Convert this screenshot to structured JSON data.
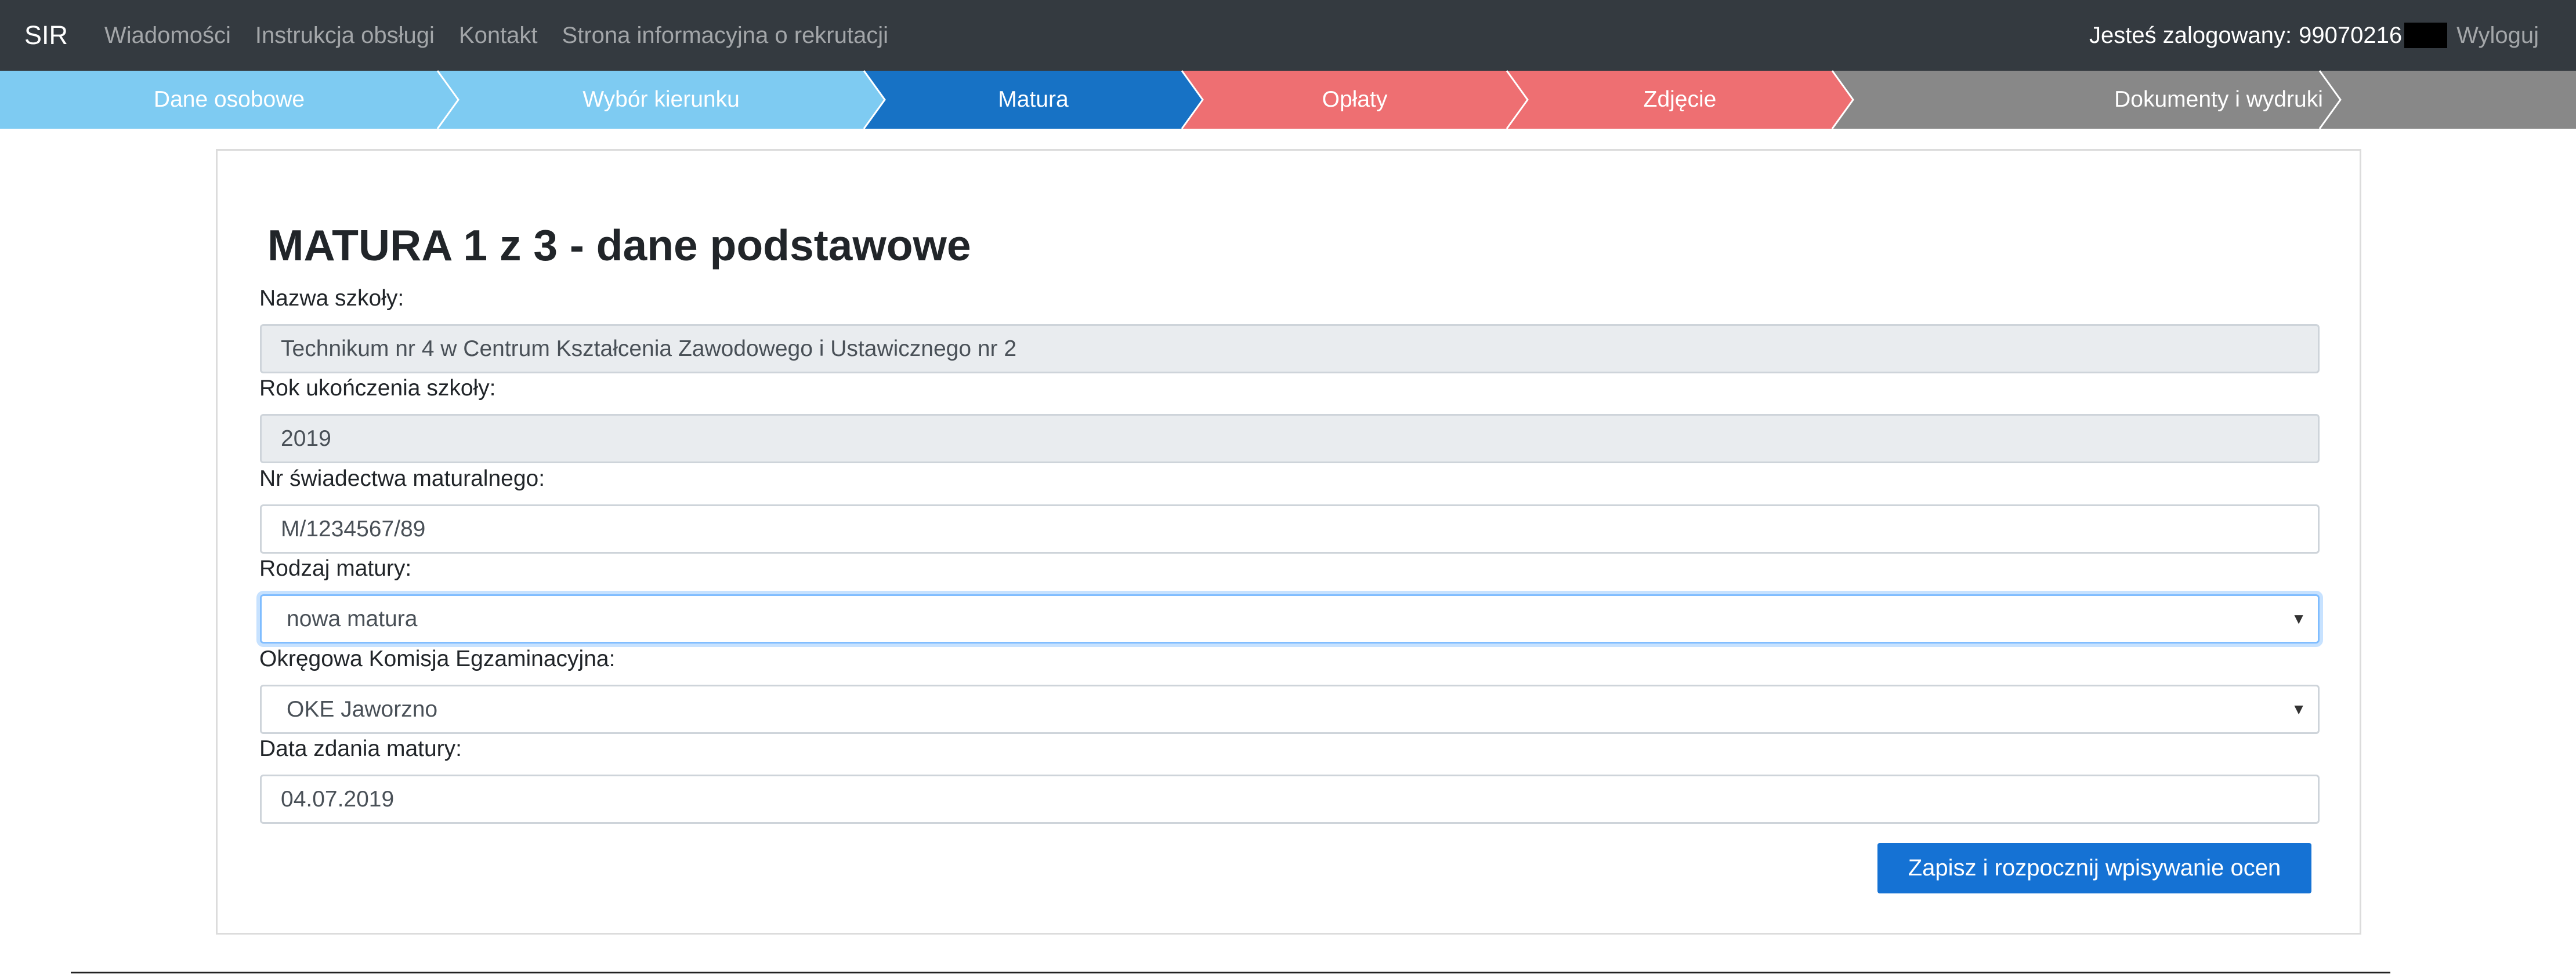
{
  "navbar": {
    "brand": "SIR",
    "links": [
      "Wiadomości",
      "Instrukcja obsługi",
      "Kontakt",
      "Strona informacyjna o rekrutacji"
    ],
    "user_label": "Jesteś zalogowany:",
    "user_id": "99070216",
    "logout": "Wyloguj"
  },
  "steps": [
    {
      "label": "Dane osobowe",
      "color": "#7ecbf2"
    },
    {
      "label": "Wybór kierunku",
      "color": "#7ecbf2"
    },
    {
      "label": "Matura",
      "color": "#1772c5"
    },
    {
      "label": "Opłaty",
      "color": "#ee6f72"
    },
    {
      "label": "Zdjęcie",
      "color": "#ee6f72"
    },
    {
      "label": "Dokumenty i wydruki",
      "color": "#888888"
    }
  ],
  "form": {
    "title": "MATURA 1 z 3 - dane podstawowe",
    "school_name": {
      "label": "Nazwa szkoły:",
      "value": "Technikum nr 4 w Centrum Kształcenia Zawodowego i Ustawicznego nr 2"
    },
    "graduation_year": {
      "label": "Rok ukończenia szkoły:",
      "value": "2019"
    },
    "certificate_number": {
      "label": "Nr świadectwa maturalnego:",
      "value": "M/1234567/89"
    },
    "matura_type": {
      "label": "Rodzaj matury:",
      "value": "nowa matura"
    },
    "exam_commission": {
      "label": "Okręgowa Komisja Egzaminacyjna:",
      "value": "OKE Jaworzno"
    },
    "exam_date": {
      "label": "Data zdania matury:",
      "value": "04.07.2019"
    },
    "save_button": "Zapisz i rozpocznij wpisywanie ocen"
  },
  "icons": {
    "dropdown": "caret-down-icon"
  }
}
